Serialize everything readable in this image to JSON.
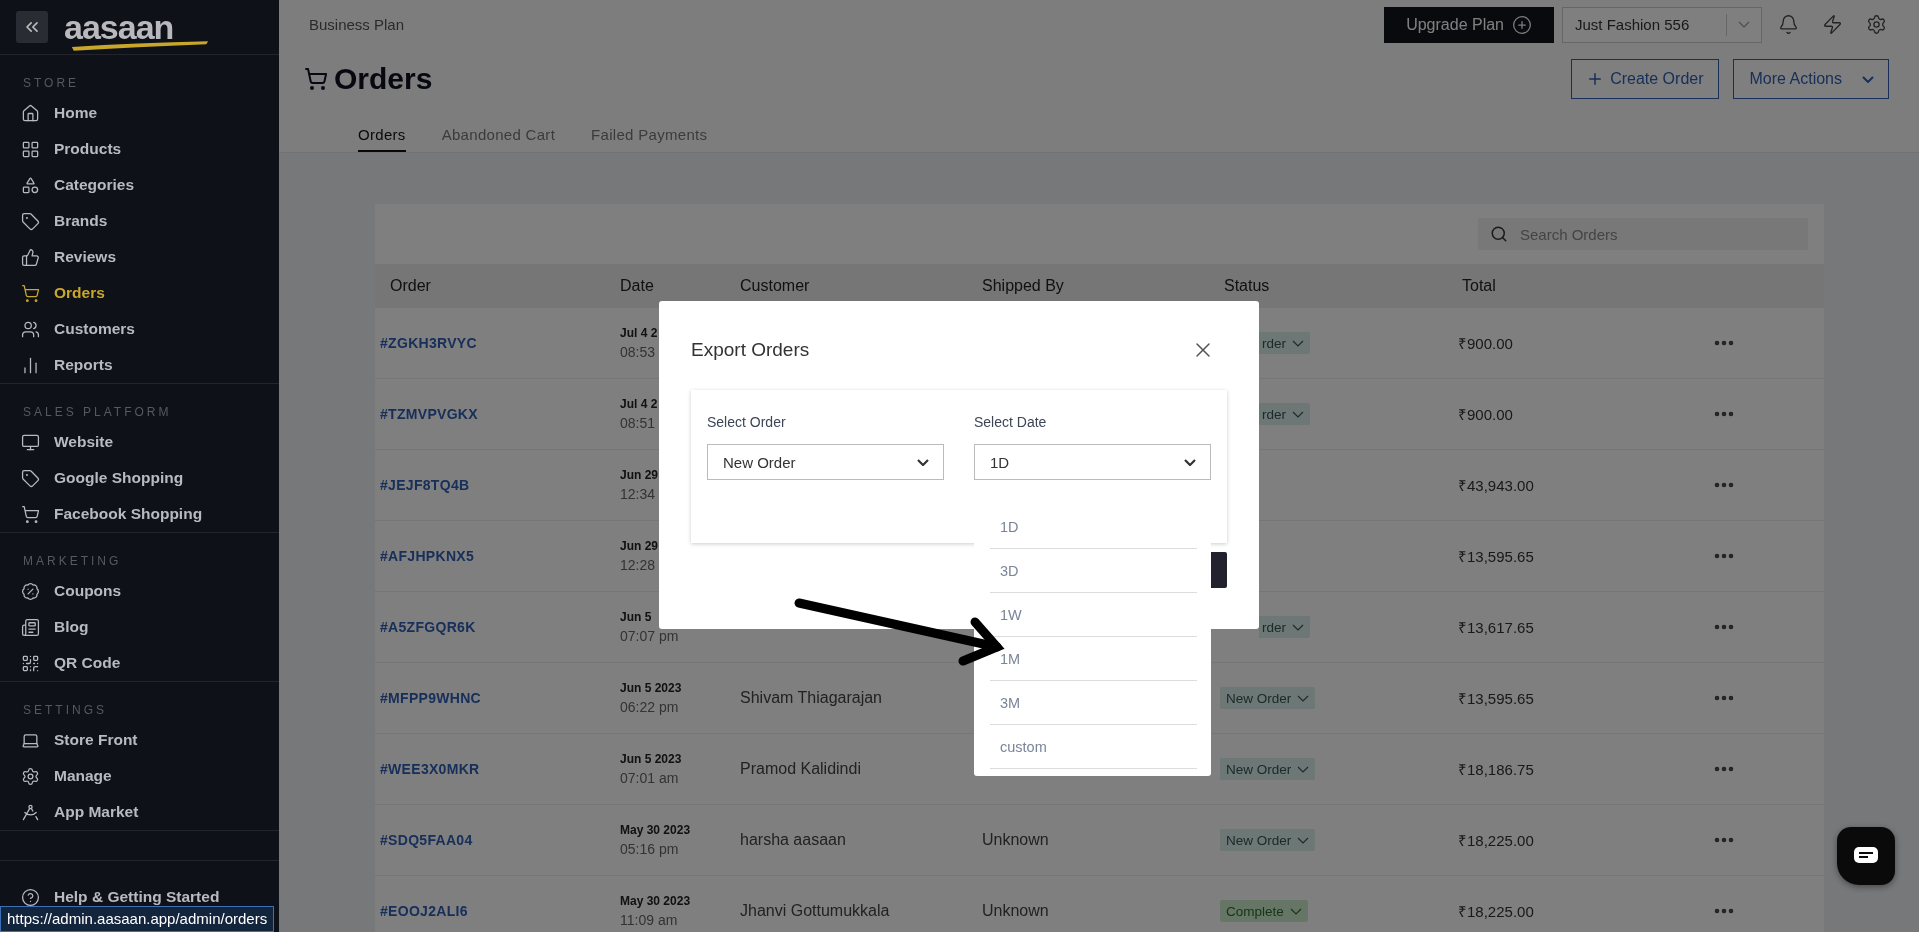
{
  "sidebar": {
    "logo": "aasaan",
    "sections": [
      {
        "title": "STORE",
        "items": [
          {
            "label": "Home",
            "selected": false
          },
          {
            "label": "Products",
            "selected": false
          },
          {
            "label": "Categories",
            "selected": false
          },
          {
            "label": "Brands",
            "selected": false
          },
          {
            "label": "Reviews",
            "selected": false
          },
          {
            "label": "Orders",
            "selected": true
          },
          {
            "label": "Customers",
            "selected": false
          },
          {
            "label": "Reports",
            "selected": false
          }
        ]
      },
      {
        "title": "SALES PLATFORM",
        "items": [
          {
            "label": "Website",
            "selected": false
          },
          {
            "label": "Google Shopping",
            "selected": false
          },
          {
            "label": "Facebook Shopping",
            "selected": false
          }
        ]
      },
      {
        "title": "MARKETING",
        "items": [
          {
            "label": "Coupons",
            "selected": false
          },
          {
            "label": "Blog",
            "selected": false
          },
          {
            "label": "QR Code",
            "selected": false
          }
        ]
      },
      {
        "title": "SETTINGS",
        "items": [
          {
            "label": "Store Front",
            "selected": false
          },
          {
            "label": "Manage",
            "selected": false
          },
          {
            "label": "App Market",
            "selected": false
          }
        ]
      }
    ],
    "help": "Help & Getting Started"
  },
  "header": {
    "plan": "Business Plan",
    "upgrade": "Upgrade Plan",
    "store": "Just Fashion 556"
  },
  "page": {
    "title": "Orders",
    "create": "Create Order",
    "more": "More Actions",
    "tabs": [
      {
        "label": "Orders",
        "selected": true
      },
      {
        "label": "Abandoned Cart",
        "selected": false
      },
      {
        "label": "Failed Payments",
        "selected": false
      }
    ]
  },
  "table": {
    "search_placeholder": "Search Orders",
    "columns": [
      "Order",
      "Date",
      "Customer",
      "Shipped By",
      "Status",
      "Total"
    ],
    "rows": [
      {
        "order": "#ZGKH3RVYC",
        "date": "Jul 4 2",
        "time": "08:53",
        "status": {
          "label": "rder",
          "cut": true,
          "kind": "new"
        },
        "total": "₹900.00"
      },
      {
        "order": "#TZMVPVGKX",
        "date": "Jul 4 2",
        "time": "08:51",
        "status": {
          "label": "rder",
          "cut": true,
          "kind": "new"
        },
        "total": "₹900.00"
      },
      {
        "order": "#JEJF8TQ4B",
        "date": "Jun 29",
        "time": "12:34",
        "total": "₹43,943.00"
      },
      {
        "order": "#AFJHPKNX5",
        "date": "Jun 29",
        "time": "12:28",
        "total": "₹13,595.65"
      },
      {
        "order": "#A5ZFGQR6K",
        "date": "Jun 5",
        "time": "07:07 pm",
        "status": {
          "label": "rder",
          "cut": true,
          "kind": "new"
        },
        "total": "₹13,617.65"
      },
      {
        "order": "#MFPP9WHNC",
        "date": "Jun 5 2023",
        "time": "06:22 pm",
        "customer": "Shivam Thiagarajan",
        "status": {
          "label": "New Order",
          "cut": false,
          "kind": "new"
        },
        "total": "₹13,595.65"
      },
      {
        "order": "#WEE3X0MKR",
        "date": "Jun 5 2023",
        "time": "07:01 am",
        "customer": "Pramod Kalidindi",
        "status": {
          "label": "New Order",
          "cut": false,
          "kind": "new"
        },
        "total": "₹18,186.75"
      },
      {
        "order": "#SDQ5FAA04",
        "date": "May 30 2023",
        "time": "05:16 pm",
        "customer": "harsha aasaan",
        "shipped": "Unknown",
        "status": {
          "label": "New Order",
          "cut": false,
          "kind": "new"
        },
        "total": "₹18,225.00"
      },
      {
        "order": "#EOOJ2ALI6",
        "date": "May 30 2023",
        "time": "11:09 am",
        "customer": "Jhanvi Gottumukkala",
        "shipped": "Unknown",
        "status": {
          "label": "Complete",
          "cut": false,
          "kind": "complete"
        },
        "total": "₹18,225.00"
      }
    ]
  },
  "modal": {
    "title": "Export Orders",
    "order_label": "Select Order",
    "order_value": "New Order",
    "date_label": "Select Date",
    "date_value": "1D",
    "date_options": [
      {
        "label": "1D",
        "selected": false
      },
      {
        "label": "3D",
        "selected": false
      },
      {
        "label": "1W",
        "selected": false
      },
      {
        "label": "1M",
        "selected": false
      },
      {
        "label": "3M",
        "selected": false
      },
      {
        "label": "custom",
        "selected": false
      }
    ]
  },
  "status_url": "https://admin.aasaan.app/admin/orders"
}
